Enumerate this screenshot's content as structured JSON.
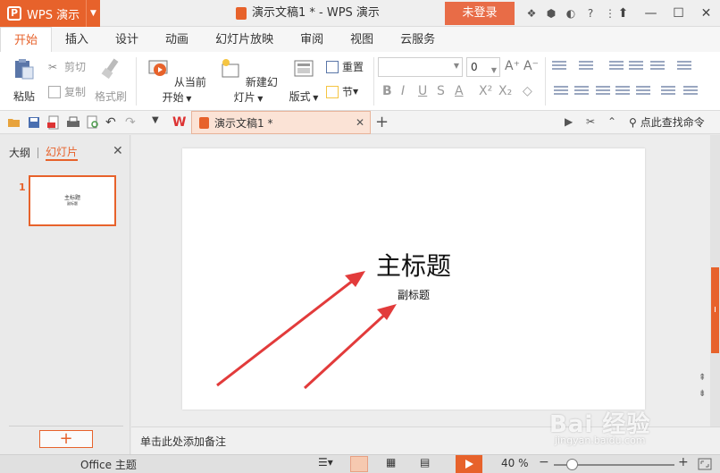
{
  "app": {
    "brand": "WPS 演示",
    "title": "演示文稿1 * - WPS 演示",
    "login": "未登录",
    "accent": "#e7622b"
  },
  "ribbon_tabs": [
    "开始",
    "插入",
    "设计",
    "动画",
    "幻灯片放映",
    "审阅",
    "视图",
    "云服务"
  ],
  "ribbon": {
    "paste": "粘贴",
    "cut": "剪切",
    "copy": "复制",
    "format_painter": "格式刷",
    "from_current": "从当前开始",
    "new_slide": "新建幻灯片",
    "layout": "版式",
    "reset": "重置",
    "section": "节",
    "font_size": "0"
  },
  "quickbar": {
    "doc_tab": "演示文稿1 *",
    "search_cmd": "点此查找命令"
  },
  "left_panel": {
    "tab_outline": "大纲",
    "tab_slides": "幻灯片",
    "slide_number": "1",
    "thumb_title": "主标题",
    "thumb_subtitle": "副标题"
  },
  "slide": {
    "main_title": "主标题",
    "subtitle": "副标题"
  },
  "notes_placeholder": "单击此处添加备注",
  "status": {
    "theme": "Office 主题",
    "zoom": "40 %",
    "zoom_value": 40
  },
  "watermark": {
    "logo": "Bai 经验",
    "url": "jingyan.baidu.com"
  }
}
